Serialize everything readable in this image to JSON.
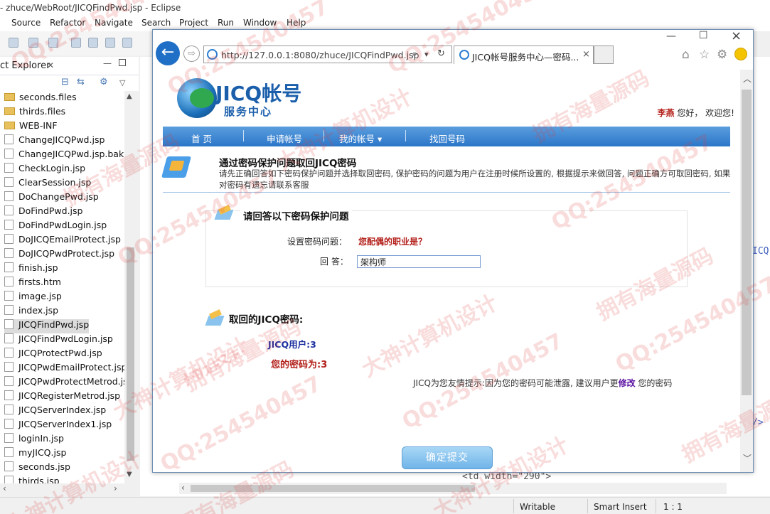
{
  "eclipse": {
    "title": "- zhuce/WebRoot/JICQFindPwd.jsp - Eclipse",
    "menu": [
      "Source",
      "Refactor",
      "Navigate",
      "Search",
      "Project",
      "Run",
      "Window",
      "Help"
    ],
    "explorer_title": "ct Explorer",
    "files": [
      {
        "name": "seconds.files",
        "kind": "folder"
      },
      {
        "name": "thirds.files",
        "kind": "folder"
      },
      {
        "name": "WEB-INF",
        "kind": "folder"
      },
      {
        "name": "ChangeJICQPwd.jsp",
        "kind": "file"
      },
      {
        "name": "ChangeJICQPwd.jsp.bak",
        "kind": "file"
      },
      {
        "name": "CheckLogin.jsp",
        "kind": "file"
      },
      {
        "name": "ClearSession.jsp",
        "kind": "file"
      },
      {
        "name": "DoChangePwd.jsp",
        "kind": "file"
      },
      {
        "name": "DoFindPwd.jsp",
        "kind": "file"
      },
      {
        "name": "DoFindPwdLogin.jsp",
        "kind": "file"
      },
      {
        "name": "DoJICQEmailProtect.jsp",
        "kind": "file"
      },
      {
        "name": "DoJICQPwdProtect.jsp",
        "kind": "file"
      },
      {
        "name": "finish.jsp",
        "kind": "file"
      },
      {
        "name": "firsts.htm",
        "kind": "file"
      },
      {
        "name": "image.jsp",
        "kind": "file"
      },
      {
        "name": "index.jsp",
        "kind": "file"
      },
      {
        "name": "JICQFindPwd.jsp",
        "kind": "file"
      },
      {
        "name": "JICQFindPwdLogin.jsp",
        "kind": "file"
      },
      {
        "name": "JICQProtectPwd.jsp",
        "kind": "file"
      },
      {
        "name": "JICQPwdEmailProtect.jsp",
        "kind": "file"
      },
      {
        "name": "JICQPwdProtectMetrod.js",
        "kind": "file"
      },
      {
        "name": "JICQRegisterMetrod.jsp",
        "kind": "file"
      },
      {
        "name": "JICQServerIndex.jsp",
        "kind": "file"
      },
      {
        "name": "JICQServerIndex1.jsp",
        "kind": "file"
      },
      {
        "name": "loginIn.jsp",
        "kind": "file"
      },
      {
        "name": "myJICQ.jsp",
        "kind": "file"
      },
      {
        "name": "seconds.jsp",
        "kind": "file"
      },
      {
        "name": "thirds.jsp",
        "kind": "file"
      }
    ],
    "selected_file_index": 16,
    "editor_text_right": "ICQ",
    "editor_text_right2": "/>",
    "editor_line": "<td width=\"290\">",
    "status": {
      "mode": "Writable",
      "insert": "Smart Insert",
      "pos": "1 : 1"
    }
  },
  "browser": {
    "url": "http://127.0.0.1:8080/zhuce/JICQFindPwd.jsp",
    "tab_label": "JICQ帐号服务中心—密码...",
    "back_glyph": "←",
    "fwd_glyph": "⇨",
    "search_glyph": "⌕",
    "refresh_glyph": "↻",
    "dropdown_glyph": "▾",
    "home_glyph": "⌂",
    "star_glyph": "☆",
    "gear_glyph": "⚙",
    "close_glyph": "×",
    "min_glyph": "—",
    "max_glyph": "☐"
  },
  "site": {
    "logo_title": "JICQ帐号",
    "logo_sub": "服务中心",
    "greeting_user": "李燕",
    "greeting_text": "您好， 欢迎您!",
    "nav": [
      "首 页",
      "申请帐号",
      "我的帐号 ▾",
      "找回号码"
    ],
    "intro_title": "通过密码保护问题取回JICQ密码",
    "intro_text": "请先正确回答如下密码保护问题并选择取回密码, 保护密码的问题为用户在注册时候所设置的, 根据提示来做回答, 问题正确方可取回密码, 如果对密码有遗忘请联系客服",
    "q_section_title": "请回答以下密码保护问题",
    "q_label": "设置密码问题：",
    "q_value": "您配偶的职业是？",
    "a_label": "回  答：",
    "a_value": "架构师",
    "result_title": "取回的JICQ密码:",
    "result_user": "JICQ用户:3",
    "result_pwd": "您的密码为:3",
    "tip_prefix": "JICQ为您友情提示:因为您的密码可能泄露, 建议用户更",
    "tip_link": "修改",
    "tip_suffix": " 您的密码",
    "submit_label": "确定提交"
  },
  "watermark": {
    "qq": "QQ:254540457",
    "cn1": "拥有海量源码",
    "cn2": "大神计算机设计"
  },
  "colors": {
    "accent": "#2b76c9",
    "warn_red": "#b3201a",
    "link_purple": "#5a0fa0"
  }
}
